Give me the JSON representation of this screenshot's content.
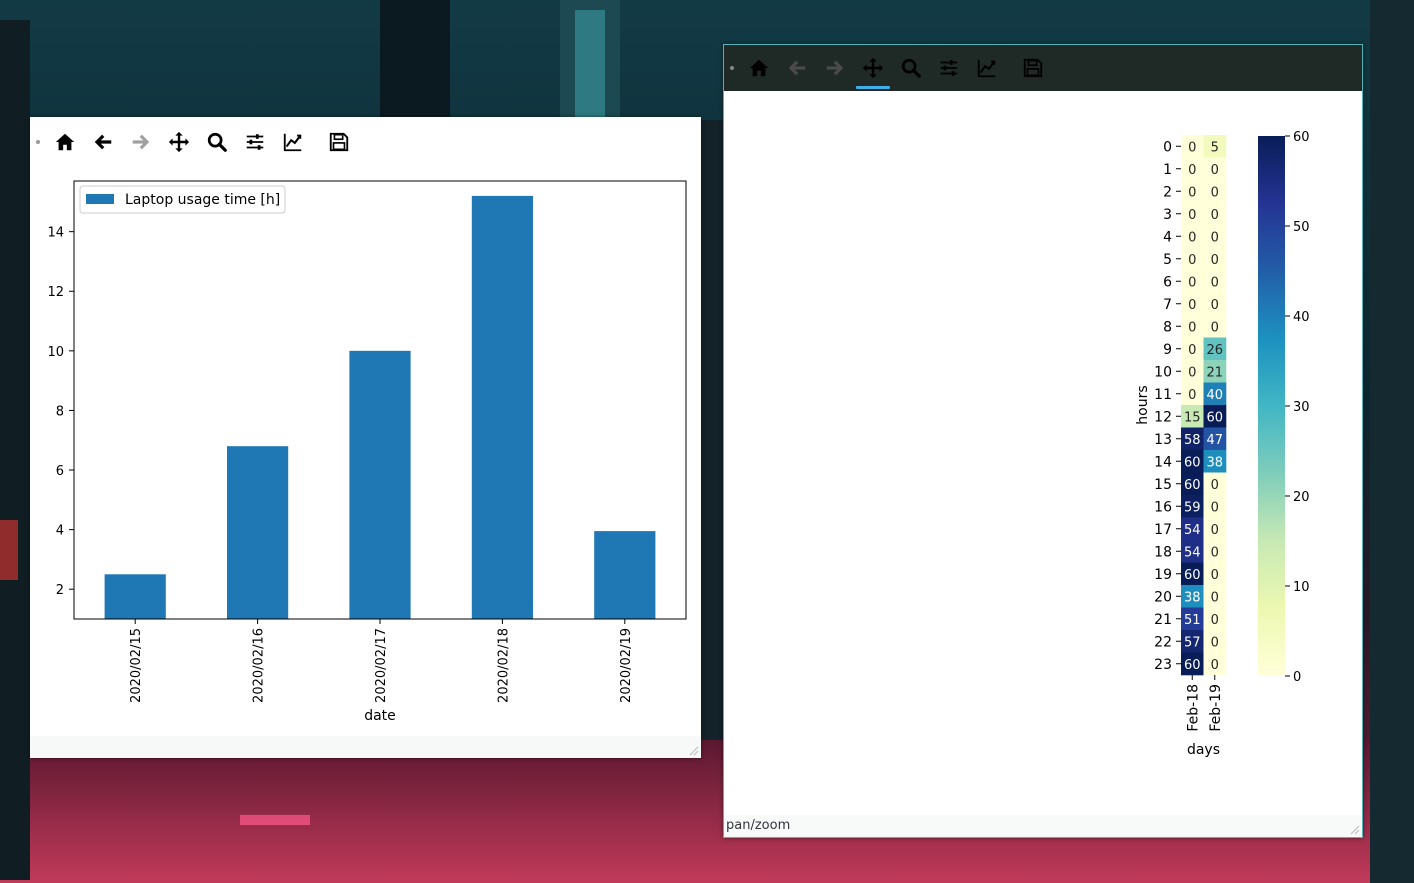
{
  "colors": {
    "bar": "#1f77b4",
    "toolbar_dark": "#1f2a27",
    "active_underline": "#3daee9"
  },
  "bar_window": {
    "toolbar": {
      "icons": [
        "home-icon",
        "back-icon",
        "forward-icon",
        "pan-icon",
        "zoom-icon",
        "subplots-icon",
        "customize-icon",
        "save-icon"
      ]
    },
    "status": ""
  },
  "heat_window": {
    "toolbar": {
      "icons": [
        "home-icon",
        "back-icon",
        "forward-icon",
        "pan-icon",
        "zoom-icon",
        "subplots-icon",
        "customize-icon",
        "save-icon"
      ],
      "active": "pan-icon"
    },
    "status": "pan/zoom"
  },
  "chart_data": [
    {
      "type": "bar",
      "categories": [
        "2020/02/15",
        "2020/02/16",
        "2020/02/17",
        "2020/02/18",
        "2020/02/19"
      ],
      "series": [
        {
          "name": "Laptop usage time [h]",
          "values": [
            2.5,
            6.8,
            10.0,
            15.2,
            3.95
          ]
        }
      ],
      "xlabel": "date",
      "ylabel": "",
      "ylim": [
        1.0,
        15.7
      ],
      "yticks": [
        2,
        4,
        6,
        8,
        10,
        12,
        14
      ],
      "legend": "top-left",
      "grid": false
    },
    {
      "type": "heatmap",
      "columns": [
        "Feb-18",
        "Feb-19"
      ],
      "rows": [
        "0",
        "1",
        "2",
        "3",
        "4",
        "5",
        "6",
        "7",
        "8",
        "9",
        "10",
        "11",
        "12",
        "13",
        "14",
        "15",
        "16",
        "17",
        "18",
        "19",
        "20",
        "21",
        "22",
        "23"
      ],
      "values": [
        [
          0,
          5
        ],
        [
          0,
          0
        ],
        [
          0,
          0
        ],
        [
          0,
          0
        ],
        [
          0,
          0
        ],
        [
          0,
          0
        ],
        [
          0,
          0
        ],
        [
          0,
          0
        ],
        [
          0,
          0
        ],
        [
          0,
          26
        ],
        [
          0,
          21
        ],
        [
          0,
          40
        ],
        [
          15,
          60
        ],
        [
          58,
          47
        ],
        [
          60,
          38
        ],
        [
          60,
          0
        ],
        [
          59,
          0
        ],
        [
          54,
          0
        ],
        [
          54,
          0
        ],
        [
          60,
          0
        ],
        [
          38,
          0
        ],
        [
          51,
          0
        ],
        [
          57,
          0
        ],
        [
          60,
          0
        ]
      ],
      "xlabel": "days",
      "ylabel": "hours",
      "colormap": "YlGnBu",
      "colorbar": {
        "min": 0,
        "max": 60,
        "ticks": [
          0,
          10,
          20,
          30,
          40,
          50,
          60
        ]
      },
      "annotated": true
    }
  ]
}
